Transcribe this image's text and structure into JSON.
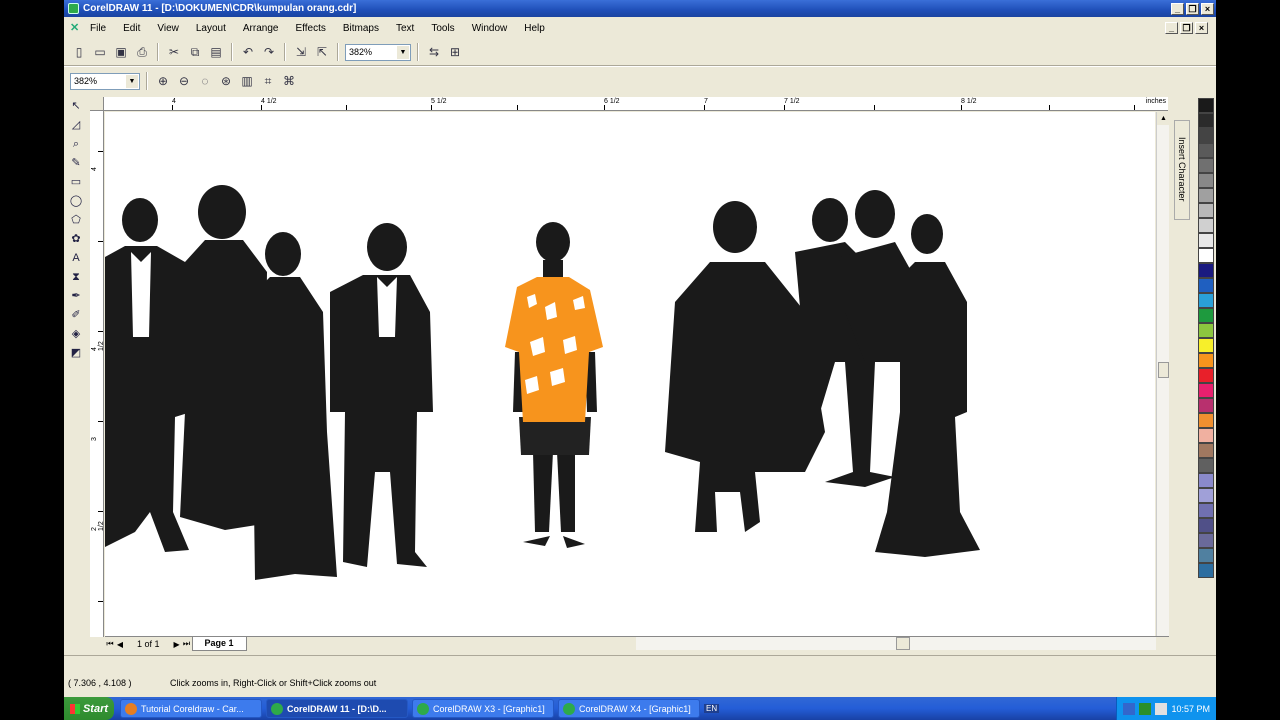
{
  "window": {
    "title": "CorelDRAW 11 - [D:\\DOKUMEN\\CDR\\kumpulan orang.cdr]"
  },
  "menu": [
    "File",
    "Edit",
    "View",
    "Layout",
    "Arrange",
    "Effects",
    "Bitmaps",
    "Text",
    "Tools",
    "Window",
    "Help"
  ],
  "toolbar": {
    "zoom_value": "382%"
  },
  "propertybar": {
    "zoom_value": "382%"
  },
  "ruler": {
    "units": "inches",
    "h_labels": [
      "4",
      "4 1/2",
      "5 1/2",
      "6 1/2",
      "7",
      "7 1/2",
      "8 1/2"
    ],
    "v_labels": [
      "4",
      "4 1/2",
      "3",
      "2 1/2"
    ]
  },
  "page_nav": {
    "count": "1 of 1",
    "tab": "Page 1"
  },
  "docker": {
    "label": "Insert Character"
  },
  "palette": [
    "#1a1a1a",
    "#2b2b2b",
    "#444444",
    "#5a5a5a",
    "#707070",
    "#888888",
    "#a0a0a0",
    "#b8b8b8",
    "#d0d0d0",
    "#e8e8e8",
    "#ffffff",
    "#1a1a80",
    "#1f5fc0",
    "#2aa0d8",
    "#1e9a3e",
    "#8cc63f",
    "#f7ef2a",
    "#f7941d",
    "#e8202a",
    "#e8206e",
    "#b8306e",
    "#f09030",
    "#f0b0a0",
    "#a07860",
    "#606060",
    "#8a8acb",
    "#a0a0d8",
    "#7070b0",
    "#505088",
    "#6a6a9a",
    "#5080a0",
    "#2d6ea0"
  ],
  "status": {
    "coords": "( 7.306 , 4.108 )",
    "hint": "Click zooms in, Right-Click or Shift+Click zooms out"
  },
  "taskbar": {
    "start": "Start",
    "tasks": [
      "Tutorial Coreldraw - Car...",
      "CorelDRAW 11 - [D:\\D...",
      "CorelDRAW X3 - [Graphic1]",
      "CorelDRAW X4 - [Graphic1]"
    ],
    "lang": "EN",
    "clock": "10:57 PM"
  },
  "colors": {
    "silhouette": "#1a1a1a",
    "shirt": "#f7941d",
    "shorts": "#222222"
  }
}
